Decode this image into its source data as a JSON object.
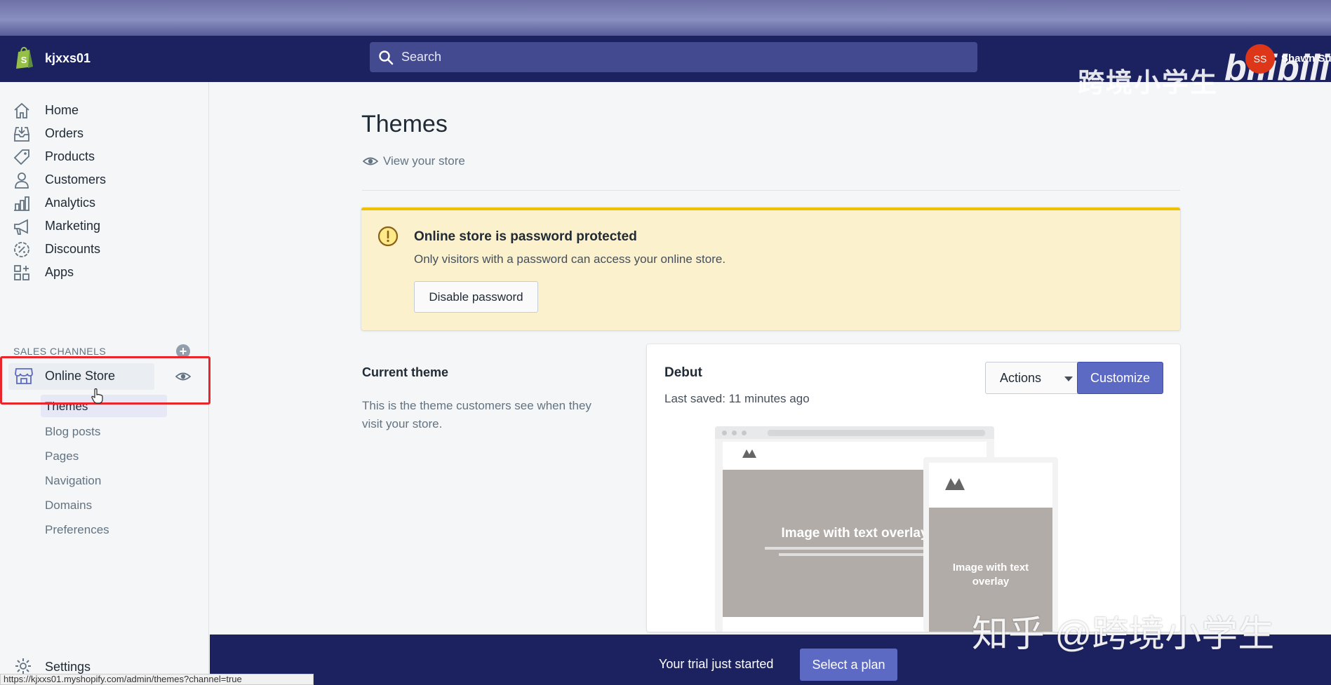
{
  "topbar": {
    "store_name": "kjxxs01",
    "search_placeholder": "Search",
    "avatar_initials": "SS",
    "user_name": "Shawn Su",
    "watermark_title": "跨境小学生",
    "watermark_logo": "bilibili"
  },
  "sidebar": {
    "items": [
      {
        "label": "Home",
        "icon": "home-icon"
      },
      {
        "label": "Orders",
        "icon": "orders-icon"
      },
      {
        "label": "Products",
        "icon": "tag-icon"
      },
      {
        "label": "Customers",
        "icon": "person-icon"
      },
      {
        "label": "Analytics",
        "icon": "bar-chart-icon"
      },
      {
        "label": "Marketing",
        "icon": "megaphone-icon"
      },
      {
        "label": "Discounts",
        "icon": "discount-icon"
      },
      {
        "label": "Apps",
        "icon": "apps-icon"
      }
    ],
    "sales_channels_title": "SALES CHANNELS",
    "online_store": "Online Store",
    "sub_items": [
      "Themes",
      "Blog posts",
      "Pages",
      "Navigation",
      "Domains",
      "Preferences"
    ],
    "settings": "Settings"
  },
  "status_url": "https://kjxxs01.myshopify.com/admin/themes?channel=true",
  "main": {
    "title": "Themes",
    "view_store": "View your store",
    "banner": {
      "title": "Online store is password protected",
      "message": "Only visitors with a password can access your online store.",
      "button": "Disable password"
    },
    "current_theme": {
      "title": "Current theme",
      "description": "This is the theme customers see when they visit your store.",
      "theme_name": "Debut",
      "last_saved": "Last saved: 11 minutes ago",
      "actions_label": "Actions",
      "customize_label": "Customize",
      "preview_desktop_text": "Image with text overlay",
      "preview_mobile_text": "Image with text overlay"
    }
  },
  "trial": {
    "message": "Your trial just started",
    "button": "Select a plan"
  },
  "watermark_bottom": "知乎 @跨境小学生",
  "colors": {
    "topbar": "#1c2260",
    "accent": "#5c6ac4",
    "banner_bg": "#fcf1cd",
    "banner_border": "#eec200",
    "highlight": "#e8262b"
  }
}
